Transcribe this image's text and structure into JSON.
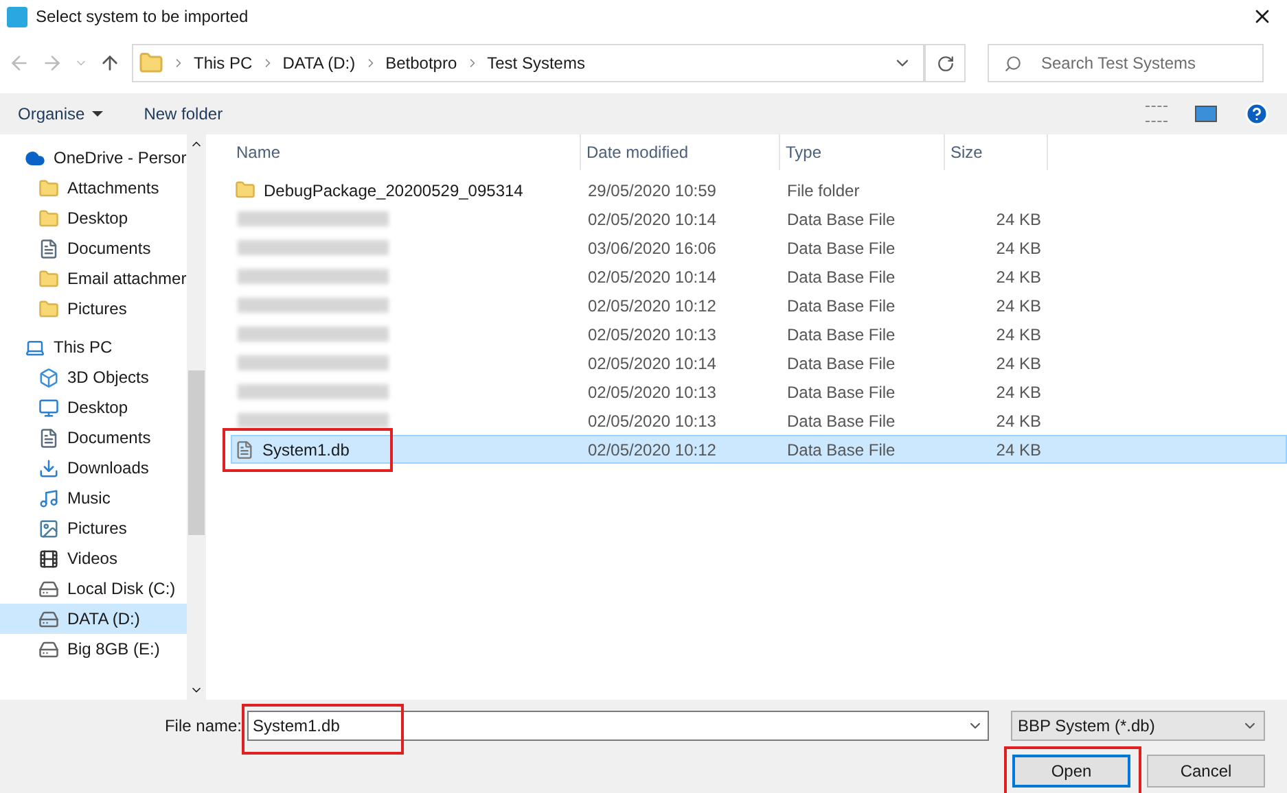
{
  "window": {
    "title": "Select system to be imported"
  },
  "address": {
    "path": [
      "This PC",
      "DATA (D:)",
      "Betbotpro",
      "Test Systems"
    ]
  },
  "search": {
    "placeholder": "Search Test Systems"
  },
  "toolbar": {
    "organise": "Organise",
    "new_folder": "New folder"
  },
  "sidebar": {
    "items": [
      {
        "label": "OneDrive - Persor",
        "selected": false,
        "children": [
          {
            "label": "Attachments",
            "selected": false
          },
          {
            "label": "Desktop",
            "selected": false
          },
          {
            "label": "Documents",
            "selected": false
          },
          {
            "label": "Email attachmer",
            "selected": false
          },
          {
            "label": "Pictures",
            "selected": false
          }
        ]
      },
      {
        "label": "This PC",
        "selected": false,
        "children": [
          {
            "label": "3D Objects",
            "selected": false
          },
          {
            "label": "Desktop",
            "selected": false
          },
          {
            "label": "Documents",
            "selected": false
          },
          {
            "label": "Downloads",
            "selected": false
          },
          {
            "label": "Music",
            "selected": false
          },
          {
            "label": "Pictures",
            "selected": false
          },
          {
            "label": "Videos",
            "selected": false
          },
          {
            "label": "Local Disk (C:)",
            "selected": false
          },
          {
            "label": "DATA (D:)",
            "selected": true
          },
          {
            "label": "Big 8GB (E:)",
            "selected": false
          }
        ]
      }
    ]
  },
  "table": {
    "columns": [
      "Name",
      "Date modified",
      "Type",
      "Size"
    ],
    "rows": [
      {
        "kind": "folder",
        "name": "DebugPackage_20200529_095314",
        "date": "29/05/2020 10:59",
        "type": "File folder",
        "selected": false,
        "highlighted": false
      },
      {
        "kind": "blurred",
        "date": "02/05/2020 10:14",
        "type": "Data Base File",
        "size": "24 KB",
        "selected": false,
        "highlighted": false
      },
      {
        "kind": "blurred",
        "date": "03/06/2020 16:06",
        "type": "Data Base File",
        "size": "24 KB",
        "selected": false,
        "highlighted": false
      },
      {
        "kind": "blurred",
        "date": "02/05/2020 10:14",
        "type": "Data Base File",
        "size": "24 KB",
        "selected": false,
        "highlighted": false
      },
      {
        "kind": "blurred",
        "date": "02/05/2020 10:12",
        "type": "Data Base File",
        "size": "24 KB",
        "selected": false,
        "highlighted": false
      },
      {
        "kind": "blurred",
        "date": "02/05/2020 10:13",
        "type": "Data Base File",
        "size": "24 KB",
        "selected": false,
        "highlighted": false
      },
      {
        "kind": "blurred",
        "date": "02/05/2020 10:14",
        "type": "Data Base File",
        "size": "24 KB",
        "selected": false,
        "highlighted": false
      },
      {
        "kind": "blurred",
        "date": "02/05/2020 10:13",
        "type": "Data Base File",
        "size": "24 KB",
        "selected": false,
        "highlighted": false
      },
      {
        "kind": "blurred",
        "date": "02/05/2020 10:13",
        "type": "Data Base File",
        "size": "24 KB",
        "selected": false,
        "highlighted": false
      },
      {
        "kind": "file",
        "name": "System1.db",
        "date": "02/05/2020 10:12",
        "type": "Data Base File",
        "size": "24 KB",
        "selected": true,
        "highlighted": true
      }
    ]
  },
  "file_name": {
    "label": "File name:",
    "value": "System1.db",
    "highlighted": true
  },
  "file_type": {
    "value": "BBP System (*.db)"
  },
  "buttons": [
    {
      "label": "Open",
      "default": true,
      "highlighted": true
    },
    {
      "label": "Cancel",
      "default": false,
      "highlighted": false
    }
  ]
}
